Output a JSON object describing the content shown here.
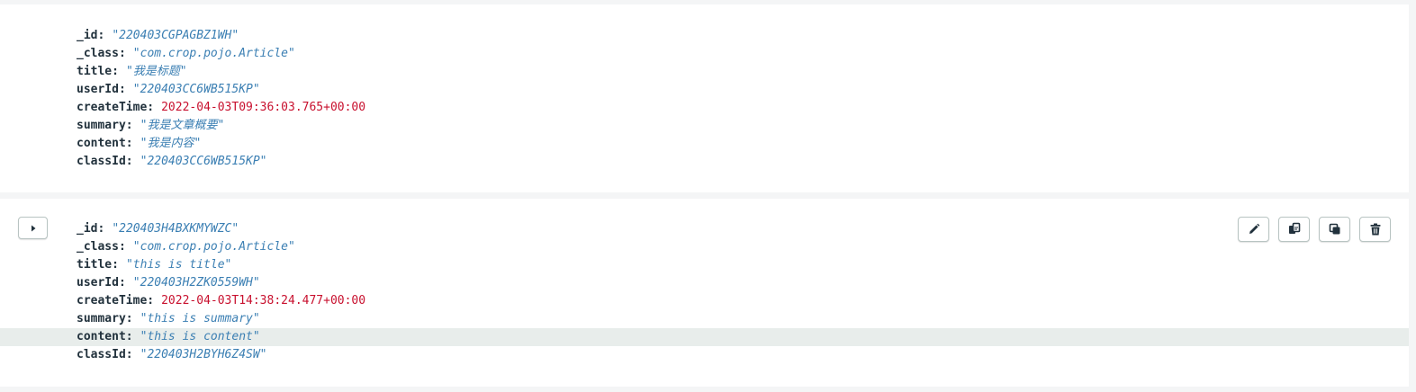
{
  "documents": [
    {
      "fields": [
        {
          "key": "_id",
          "value": "\"220403CGPAGBZ1WH\"",
          "type": "string"
        },
        {
          "key": "_class",
          "value": "\"com.crop.pojo.Article\"",
          "type": "string"
        },
        {
          "key": "title",
          "value": "\"我是标题\"",
          "type": "string"
        },
        {
          "key": "userId",
          "value": "\"220403CC6WB515KP\"",
          "type": "string"
        },
        {
          "key": "createTime",
          "value": "2022-04-03T09:36:03.765+00:00",
          "type": "date"
        },
        {
          "key": "summary",
          "value": "\"我是文章概要\"",
          "type": "string"
        },
        {
          "key": "content",
          "value": "\"我是内容\"",
          "type": "string"
        },
        {
          "key": "classId",
          "value": "\"220403CC6WB515KP\"",
          "type": "string"
        }
      ]
    },
    {
      "fields": [
        {
          "key": "_id",
          "value": "\"220403H4BXKMYWZC\"",
          "type": "string"
        },
        {
          "key": "_class",
          "value": "\"com.crop.pojo.Article\"",
          "type": "string"
        },
        {
          "key": "title",
          "value": "\"this is title\"",
          "type": "string"
        },
        {
          "key": "userId",
          "value": "\"220403H2ZK0559WH\"",
          "type": "string"
        },
        {
          "key": "createTime",
          "value": "2022-04-03T14:38:24.477+00:00",
          "type": "date"
        },
        {
          "key": "summary",
          "value": "\"this is summary\"",
          "type": "string"
        },
        {
          "key": "content",
          "value": "\"this is content\"",
          "type": "string"
        },
        {
          "key": "classId",
          "value": "\"220403H2BYH6Z4SW\"",
          "type": "string"
        }
      ]
    }
  ],
  "icons": {
    "expand": "triangle-right-icon",
    "edit": "pencil-icon",
    "copy": "copy-document-icon",
    "clone": "clone-document-icon",
    "delete": "trash-icon"
  },
  "colors": {
    "field_key": "#21313c",
    "string_value": "#3b7fb3",
    "date_value": "#c8102e",
    "highlight_row": "#e8edeb",
    "page_background": "#f4f5f6"
  }
}
